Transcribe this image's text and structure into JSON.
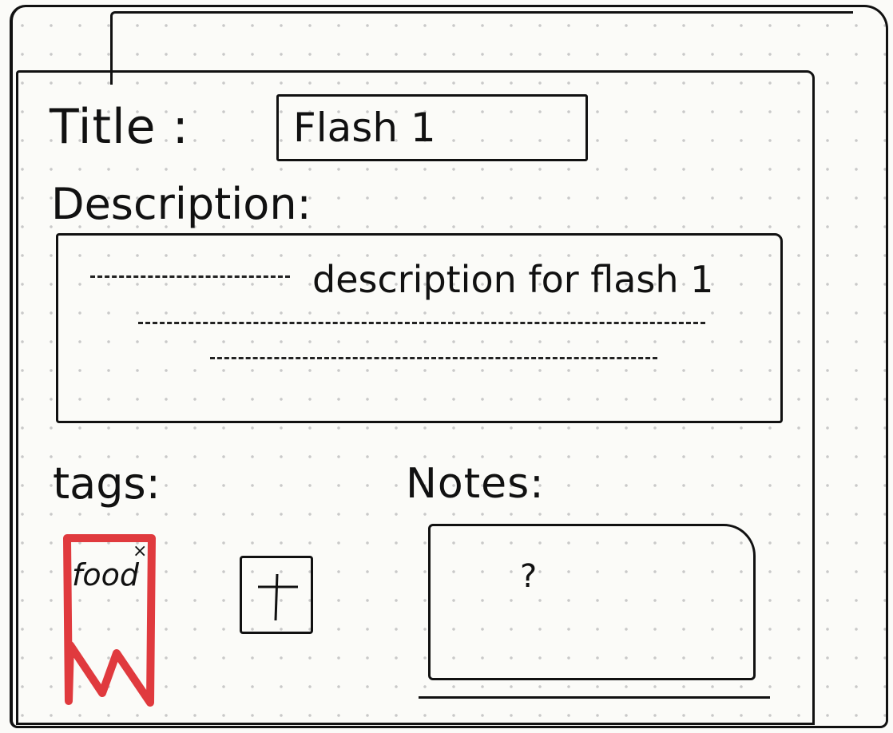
{
  "form": {
    "title_label": "Title :",
    "title_value": "Flash 1",
    "description_label": "Description:",
    "description_value": "description for flash 1",
    "tags_label": "tags:",
    "notes_label": "Notes:",
    "notes_value": "?"
  },
  "tags": [
    {
      "label": "food",
      "remove_glyph": "×",
      "color": "#e03a3e"
    }
  ],
  "add_tag_glyph": "+",
  "colors": {
    "ink": "#111111",
    "tag_red": "#e03a3e",
    "paper": "#fbfbf8",
    "grid_dot": "#c9c9c9"
  }
}
